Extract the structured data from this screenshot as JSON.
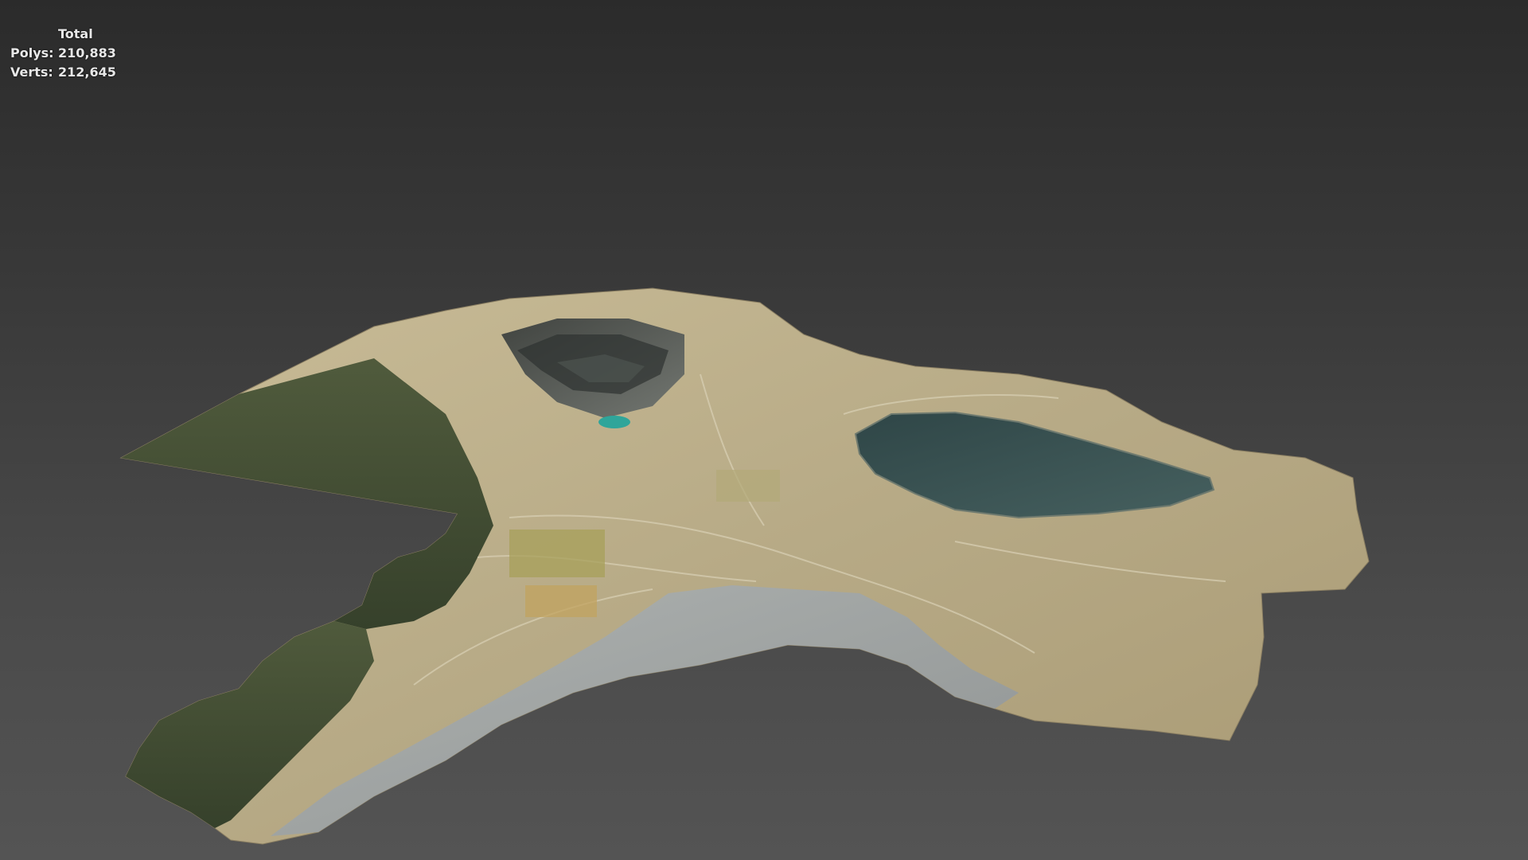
{
  "stats": {
    "title": "Total",
    "polys_label": "Polys:",
    "polys_value": "210,883",
    "verts_label": "Verts:",
    "verts_value": "212,645"
  },
  "colors": {
    "background_top": "#2b2b2b",
    "background_bottom": "#545454",
    "forest": "#3c4a2e",
    "bare_ground": "#b9ad8a",
    "pit_lake": "#3b5556",
    "tailings": "#9aa0a2",
    "small_pond": "#2fa59a"
  }
}
